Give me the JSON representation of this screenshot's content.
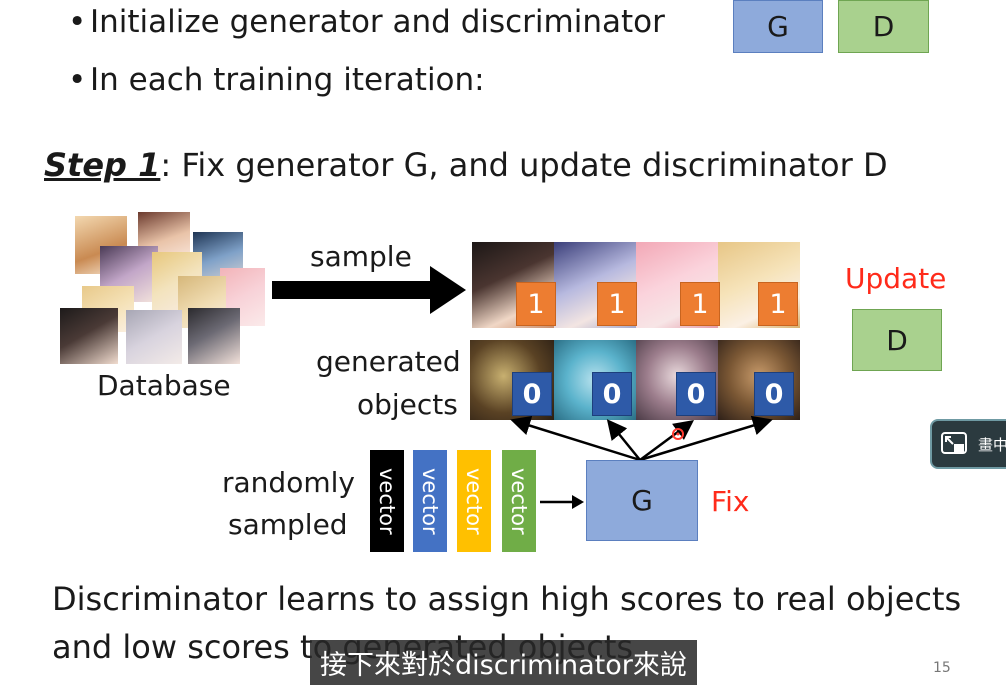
{
  "bullets": [
    "Initialize generator and discriminator",
    "In each training iteration:"
  ],
  "legend": {
    "g_label": "G",
    "d_label": "D"
  },
  "step": {
    "label": "Step 1",
    "text": ": Fix generator G, and update discriminator D"
  },
  "diagram": {
    "database_label": "Database",
    "sample_label": "sample",
    "generated_label_1": "generated",
    "generated_label_2": "objects",
    "real_scores": [
      "1",
      "1",
      "1",
      "1"
    ],
    "fake_scores": [
      "0",
      "0",
      "0",
      "0"
    ],
    "randomly_label_1": "randomly",
    "randomly_label_2": "sampled",
    "vectors": [
      {
        "label": "vector",
        "color": "#000000"
      },
      {
        "label": "vector",
        "color": "#4472c4"
      },
      {
        "label": "vector",
        "color": "#ffc000"
      },
      {
        "label": "vector",
        "color": "#70ad47"
      }
    ],
    "generator_label": "G",
    "fix_label": "Fix",
    "update_label": "Update",
    "discriminator_label": "D"
  },
  "conclusion": {
    "line1": "Discriminator learns to assign high scores to real objects",
    "line2": "and low scores to generated objects"
  },
  "subtitle": "接下來對於discriminator來說",
  "page_number": "15",
  "pip_button": {
    "label": "畫中"
  }
}
